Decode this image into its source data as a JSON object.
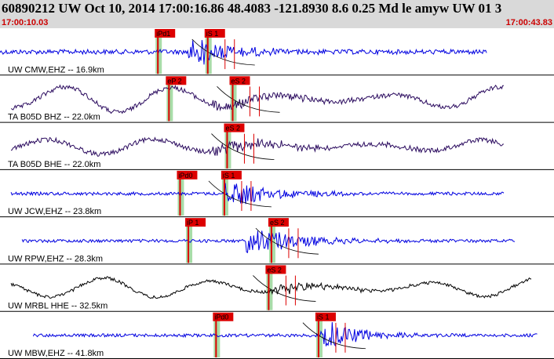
{
  "header": {
    "title": "60890212 UW Oct 10, 2014 17:00:16.86   48.4083 -121.8930  8.6 0.25 Md le amyw UW 01   3",
    "start_time": "17:00:10.03",
    "end_time": "17:00:43.83"
  },
  "colors": {
    "header_bg": "#d9d9d9",
    "time_text": "#cc0000",
    "trace_blue": "#0000e0",
    "trace_purple": "#2a0a5e",
    "trace_black": "#000000",
    "pick_marker": "#dd0000",
    "window_green": "#a8dca8"
  },
  "traces": [
    {
      "label": "UW CMW,EHZ -- 16.9km",
      "color": "blue",
      "picks": [
        {
          "text": "iPd1",
          "t": 0.285
        },
        {
          "text": "iS 1",
          "t": 0.375
        }
      ],
      "x_start": 0.0,
      "x_end": 0.88,
      "amp": 3,
      "burst_amp": 16,
      "burst_t": 0.36,
      "burst_dur": 0.07,
      "low_freq": 0
    },
    {
      "label": "TA B05D BHZ -- 22.0km",
      "color": "purple",
      "picks": [
        {
          "text": "eP 2",
          "t": 0.305
        },
        {
          "text": "eS 2",
          "t": 0.42
        }
      ],
      "x_start": 0.02,
      "x_end": 0.91,
      "amp": 3,
      "burst_amp": 6,
      "burst_t": 0.42,
      "burst_dur": 0.12,
      "low_freq": 17
    },
    {
      "label": "TA B05D BHE -- 22.0km",
      "color": "purple",
      "picks": [
        {
          "text": "eS 2",
          "t": 0.41
        }
      ],
      "x_start": 0.02,
      "x_end": 0.91,
      "amp": 3,
      "burst_amp": 7,
      "burst_t": 0.42,
      "burst_dur": 0.12,
      "low_freq": 10
    },
    {
      "label": "UW JCW,EHZ -- 23.8km",
      "color": "blue",
      "picks": [
        {
          "text": "iPd0",
          "t": 0.325
        },
        {
          "text": "iS 1",
          "t": 0.405
        }
      ],
      "x_start": 0.02,
      "x_end": 0.91,
      "amp": 2,
      "burst_amp": 15,
      "burst_t": 0.43,
      "burst_dur": 0.08,
      "low_freq": 0
    },
    {
      "label": "UW RPW,EHZ -- 28.3km",
      "color": "blue",
      "picks": [
        {
          "text": "iP 1",
          "t": 0.34
        },
        {
          "text": "eS 2",
          "t": 0.49
        }
      ],
      "x_start": 0.04,
      "x_end": 0.93,
      "amp": 2,
      "burst_amp": 15,
      "burst_t": 0.47,
      "burst_dur": 0.09,
      "low_freq": 0
    },
    {
      "label": "UW MRBL HHE -- 32.5km",
      "color": "black",
      "picks": [
        {
          "text": "eS 2",
          "t": 0.485
        }
      ],
      "x_start": 0.02,
      "x_end": 0.96,
      "amp": 2,
      "burst_amp": 6,
      "burst_t": 0.52,
      "burst_dur": 0.1,
      "low_freq": 13
    },
    {
      "label": "UW MBW,EHZ -- 41.8km",
      "color": "blue",
      "picks": [
        {
          "text": "iPd0",
          "t": 0.39
        },
        {
          "text": "iS 1",
          "t": 0.575
        }
      ],
      "x_start": 0.06,
      "x_end": 0.97,
      "amp": 2,
      "burst_amp": 16,
      "burst_t": 0.6,
      "burst_dur": 0.07,
      "low_freq": 0
    }
  ]
}
